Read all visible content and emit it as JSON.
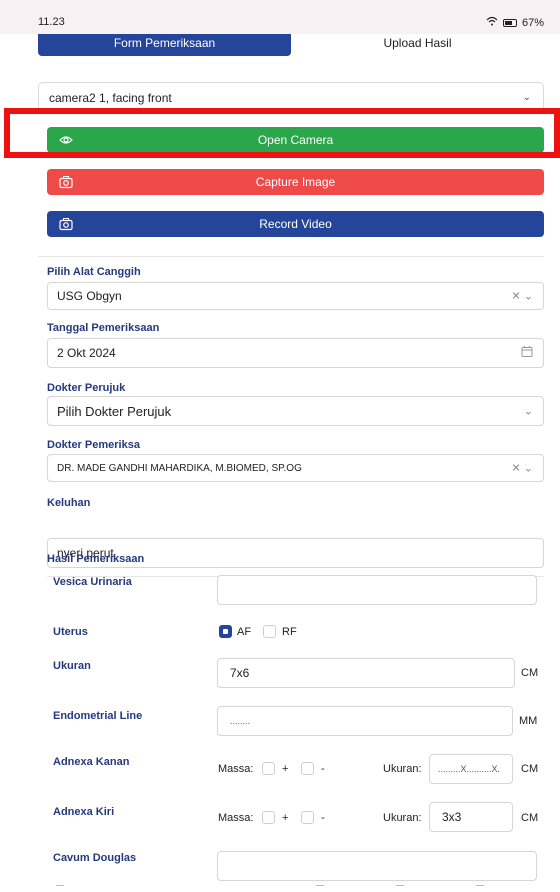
{
  "status_bar": {
    "time": "11.23",
    "battery": "67%"
  },
  "tabs": [
    {
      "label": "Form Pemeriksaan"
    },
    {
      "label": "Upload Hasil"
    }
  ],
  "camera": {
    "selected": "camera2 1, facing front",
    "open_label": "Open Camera",
    "capture_label": "Capture Image",
    "record_label": "Record Video"
  },
  "form": {
    "alat": {
      "label": "Pilih Alat Canggih",
      "value": "USG Obgyn"
    },
    "tanggal": {
      "label": "Tanggal Pemeriksaan",
      "value": "2 Okt 2024"
    },
    "perujuk": {
      "label": "Dokter Perujuk",
      "placeholder": "Pilih Dokter Perujuk"
    },
    "pemeriksa": {
      "label": "Dokter Pemeriksa",
      "value": "DR. MADE GANDHI MAHARDIKA, M.BIOMED, SP.OG"
    },
    "keluhan": {
      "label": "Keluhan",
      "value": "nyeri perut"
    }
  },
  "hasil": {
    "title": "Hasil Pemeriksaan",
    "vesica": {
      "label": "Vesica Urinaria",
      "value": ""
    },
    "uterus": {
      "label": "Uterus",
      "opt1": "AF",
      "opt2": "RF",
      "checked": "AF"
    },
    "ukuran": {
      "label": "Ukuran",
      "value": "7x6",
      "unit": "CM"
    },
    "endometrial": {
      "label": "Endometrial Line",
      "placeholder": "........",
      "unit": "MM"
    },
    "adnexa_kanan": {
      "label": "Adnexa Kanan",
      "massa": "Massa:",
      "plus": "+",
      "minus": "-",
      "ukuran_label": "Ukuran:",
      "placeholder": ".........X..........X.",
      "unit": "CM"
    },
    "adnexa_kiri": {
      "label": "Adnexa Kiri",
      "massa": "Massa:",
      "plus": "+",
      "minus": "-",
      "ukuran_label": "Ukuran:",
      "value": "3x3",
      "unit": "CM"
    },
    "cavum": {
      "label": "Cavum Douglas",
      "value": ""
    }
  },
  "colors": {
    "primary": "#25459a",
    "success": "#2aa74a",
    "danger": "#ee4a4a",
    "label": "#25397d",
    "highlight": "#ee1111"
  }
}
